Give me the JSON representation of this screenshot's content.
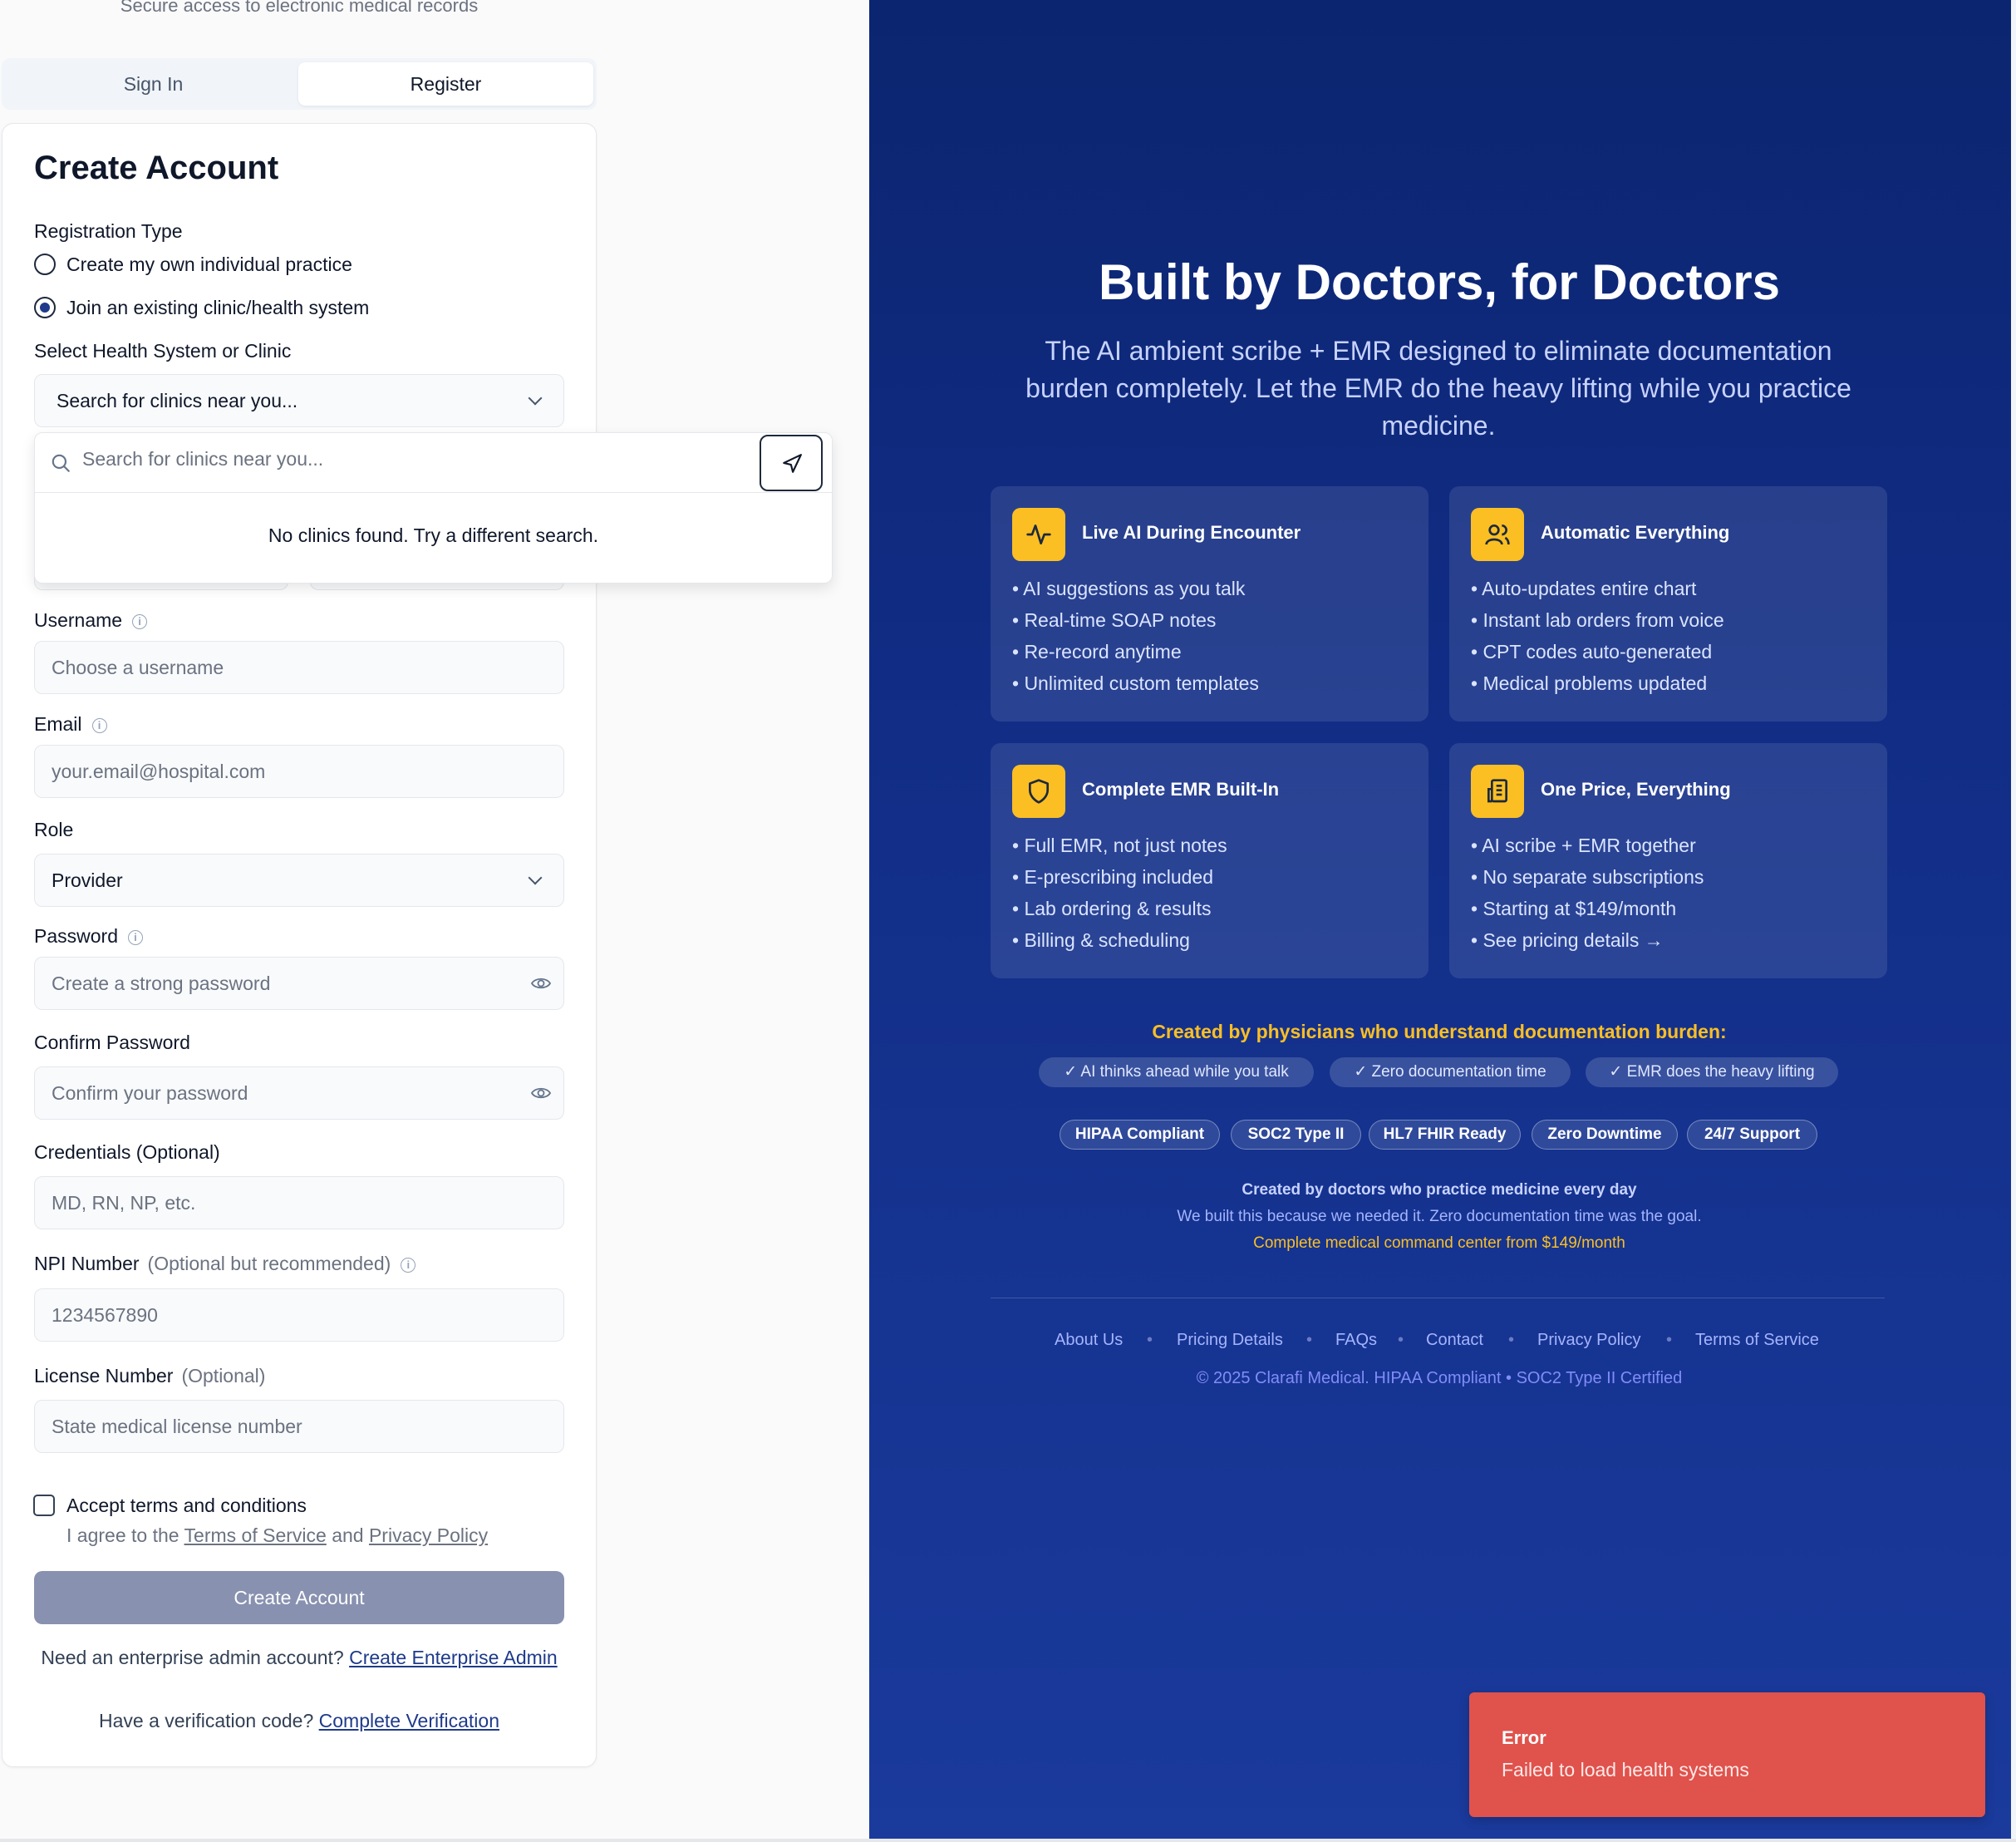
{
  "left": {
    "subtitle": "Secure access to electronic medical records",
    "tabs": {
      "signin": "Sign In",
      "register": "Register"
    },
    "card_title": "Create Account",
    "registration_type": {
      "label": "Registration Type",
      "options": [
        "Create my own individual practice",
        "Join an existing clinic/health system"
      ],
      "selected": 1
    },
    "health_system": {
      "label": "Select Health System or Clinic",
      "selected_text": "Search for clinics near you...",
      "search_placeholder": "Search for clinics near you...",
      "empty_text": "No clinics found. Try a different search."
    },
    "username": {
      "label": "Username",
      "placeholder": "Choose a username"
    },
    "email": {
      "label": "Email",
      "placeholder": "your.email@hospital.com"
    },
    "role": {
      "label": "Role",
      "value": "Provider"
    },
    "password": {
      "label": "Password",
      "placeholder": "Create a strong password"
    },
    "confirm_password": {
      "label": "Confirm Password",
      "placeholder": "Confirm your password"
    },
    "credentials": {
      "label": "Credentials (Optional)",
      "placeholder": "MD, RN, NP, etc."
    },
    "npi": {
      "label": "NPI Number",
      "hint": "(Optional but recommended)",
      "placeholder": "1234567890"
    },
    "license": {
      "label": "License Number",
      "hint": "(Optional)",
      "placeholder": "State medical license number"
    },
    "terms": {
      "label": "Accept terms and conditions",
      "prefix": "I agree to the",
      "tos": "Terms of Service",
      "and": "and",
      "privacy": "Privacy Policy"
    },
    "submit": "Create Account",
    "enterprise": {
      "prefix": "Need an enterprise admin account?",
      "link": "Create Enterprise Admin"
    },
    "verification": {
      "prefix": "Have a verification code?",
      "link": "Complete Verification"
    }
  },
  "right": {
    "title": "Built by Doctors, for Doctors",
    "subtitle_lines": [
      "The AI ambient scribe + EMR designed to eliminate documentation",
      "burden completely. Let the EMR do the heavy lifting while you practice",
      "medicine."
    ],
    "features": [
      {
        "icon": "activity-icon",
        "title": "Live AI During Encounter",
        "bullets": [
          "• AI suggestions as you talk",
          "• Real-time SOAP notes",
          "• Re-record anytime",
          "• Unlimited custom templates"
        ]
      },
      {
        "icon": "users-icon",
        "title": "Automatic Everything",
        "bullets": [
          "• Auto-updates entire chart",
          "• Instant lab orders from voice",
          "• CPT codes auto-generated",
          "• Medical problems updated"
        ]
      },
      {
        "icon": "shield-icon",
        "title": "Complete EMR Built-In",
        "bullets": [
          "• Full EMR, not just notes",
          "• E-prescribing included",
          "• Lab ordering & results",
          "• Billing & scheduling"
        ]
      },
      {
        "icon": "receipt-icon",
        "title": "One Price, Everything",
        "bullets": [
          "• AI scribe + EMR together",
          "• No separate subscriptions",
          "• Starting at $149/month",
          "• See pricing details →"
        ]
      }
    ],
    "physicians_heading": "Created by physicians who understand documentation burden:",
    "pills": [
      "✓ AI thinks ahead while you talk",
      "✓ Zero documentation time",
      "✓ EMR does the heavy lifting"
    ],
    "badges": [
      "HIPAA Compliant",
      "SOC2 Type II",
      "HL7 FHIR Ready",
      "Zero Downtime",
      "24/7 Support"
    ],
    "doctors_line": "Created by doctors who practice medicine every day",
    "built_line": "We built this because we needed it. Zero documentation time was the goal.",
    "price_line": "Complete medical command center from $149/month",
    "footer_links": [
      "About Us",
      "Pricing Details",
      "FAQs",
      "Contact",
      "Privacy Policy",
      "Terms of Service"
    ],
    "copyright": "© 2025 Clarafi Medical. HIPAA Compliant • SOC2 Type II Certified"
  },
  "toast": {
    "title": "Error",
    "message": "Failed to load health systems"
  },
  "colors": {
    "primary": "#1e3a8a",
    "panel": "#112d86",
    "accent": "#fbbf24",
    "error": "#e0524c",
    "button_disabled": "#8891b0"
  }
}
